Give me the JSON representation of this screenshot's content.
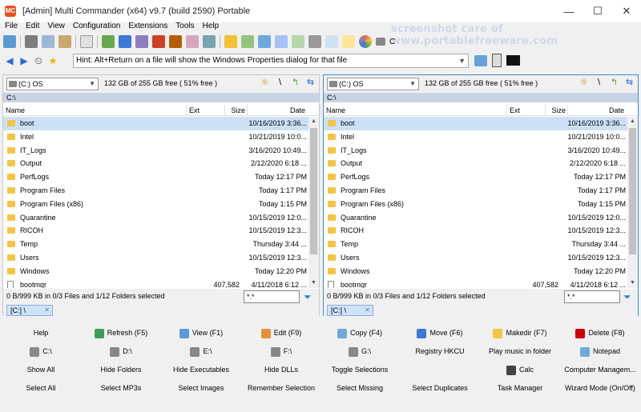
{
  "title": "[Admin] Multi Commander (x64)  v9.7 (build 2590) Portable",
  "watermark": "screenshot care of www.portablefreeware.com",
  "window_buttons": [
    "—",
    "☐",
    "✕"
  ],
  "menu": [
    "File",
    "Edit",
    "View",
    "Configuration",
    "Extensions",
    "Tools",
    "Help"
  ],
  "toolbar": {
    "drive_c_label": "C"
  },
  "hint": "Hint: Alt+Return on a file will show the Windows Properties dialog for that file",
  "colors": {
    "selection": "#cce0f5",
    "path_bar": "#c8d4e6",
    "folder": "#f5c542",
    "active_border": "#3a8fd6"
  },
  "left_panel": {
    "drive": "(C:) OS",
    "free": "132 GB of 255 GB free ( 51% free )",
    "path": "C:\\",
    "cols": {
      "name": "Name",
      "ext": "Ext",
      "size": "Size",
      "date": "Date"
    },
    "rows": [
      {
        "name": "boot",
        "size": "",
        "date": "10/16/2019 3:36...",
        "type": "folder",
        "sel": true
      },
      {
        "name": "Intel",
        "size": "",
        "date": "10/21/2019 10:0...",
        "type": "folder"
      },
      {
        "name": "IT_Logs",
        "size": "",
        "date": "3/16/2020 10:49...",
        "type": "folder"
      },
      {
        "name": "Output",
        "size": "",
        "date": "2/12/2020 6:18 ...",
        "type": "folder"
      },
      {
        "name": "PerfLogs",
        "size": "",
        "date": "Today 12:17 PM",
        "type": "folder"
      },
      {
        "name": "Program Files",
        "size": "",
        "date": "Today 1:17 PM",
        "type": "folder"
      },
      {
        "name": "Program Files (x86)",
        "size": "",
        "date": "Today 1:15 PM",
        "type": "folder"
      },
      {
        "name": "Quarantine",
        "size": "",
        "date": "10/15/2019 12:0...",
        "type": "folder"
      },
      {
        "name": "RICOH",
        "size": "",
        "date": "10/15/2019 12:3...",
        "type": "folder"
      },
      {
        "name": "Temp",
        "size": "",
        "date": "Thursday 3:44 ...",
        "type": "folder"
      },
      {
        "name": "Users",
        "size": "",
        "date": "10/15/2019 12:3...",
        "type": "folder"
      },
      {
        "name": "Windows",
        "size": "",
        "date": "Today 12:20 PM",
        "type": "folder"
      },
      {
        "name": "bootmgr",
        "size": "407,582",
        "date": "4/11/2018 6:12 ...",
        "type": "file"
      }
    ],
    "status": "0 B/999 KB in 0/3 Files and 1/12 Folders selected",
    "filter": "*.*",
    "tab": "[C:] \\"
  },
  "right_panel": {
    "drive": "(C:) OS",
    "free": "132 GB of 255 GB free ( 51% free )",
    "path": "C:\\",
    "cols": {
      "name": "Name",
      "ext": "Ext",
      "size": "Size",
      "date": "Date"
    },
    "rows": [
      {
        "name": "boot",
        "size": "",
        "date": "10/16/2019 3:36...",
        "type": "folder",
        "sel": true
      },
      {
        "name": "Intel",
        "size": "",
        "date": "10/21/2019 10:0...",
        "type": "folder"
      },
      {
        "name": "IT_Logs",
        "size": "",
        "date": "3/16/2020 10:49...",
        "type": "folder"
      },
      {
        "name": "Output",
        "size": "",
        "date": "2/12/2020 6:18 ...",
        "type": "folder"
      },
      {
        "name": "PerfLogs",
        "size": "",
        "date": "Today 12:17 PM",
        "type": "folder"
      },
      {
        "name": "Program Files",
        "size": "",
        "date": "Today 1:17 PM",
        "type": "folder"
      },
      {
        "name": "Program Files (x86)",
        "size": "",
        "date": "Today 1:15 PM",
        "type": "folder"
      },
      {
        "name": "Quarantine",
        "size": "",
        "date": "10/15/2019 12:0...",
        "type": "folder"
      },
      {
        "name": "RICOH",
        "size": "",
        "date": "10/15/2019 12:3...",
        "type": "folder"
      },
      {
        "name": "Temp",
        "size": "",
        "date": "Thursday 3:44 ...",
        "type": "folder"
      },
      {
        "name": "Users",
        "size": "",
        "date": "10/15/2019 12:3...",
        "type": "folder"
      },
      {
        "name": "Windows",
        "size": "",
        "date": "Today 12:20 PM",
        "type": "folder"
      },
      {
        "name": "bootmgr",
        "size": "407,582",
        "date": "4/11/2018 6:12 ...",
        "type": "file"
      }
    ],
    "status": "0 B/999 KB in 0/3 Files and 1/12 Folders selected",
    "filter": "*.*",
    "tab": "[C:] \\"
  },
  "buttons": [
    [
      {
        "label": "Help",
        "icon": ""
      },
      {
        "label": "Refresh (F5)",
        "icon": "refresh-icon"
      },
      {
        "label": "View (F1)",
        "icon": "view-icon"
      },
      {
        "label": "Edit (F9)",
        "icon": "edit-icon"
      },
      {
        "label": "Copy (F4)",
        "icon": "copy-icon"
      },
      {
        "label": "Move (F6)",
        "icon": "move-icon"
      },
      {
        "label": "Makedir (F7)",
        "icon": "folder-icon"
      },
      {
        "label": "Delete (F8)",
        "icon": "delete-icon"
      }
    ],
    [
      {
        "label": "C:\\",
        "icon": "drive-icon"
      },
      {
        "label": "D:\\",
        "icon": "drive-icon"
      },
      {
        "label": "E:\\",
        "icon": "drive-icon"
      },
      {
        "label": "F:\\",
        "icon": "drive-icon"
      },
      {
        "label": "G:\\",
        "icon": "drive-icon"
      },
      {
        "label": "Registry HKCU",
        "icon": ""
      },
      {
        "label": "Play music in folder",
        "icon": ""
      },
      {
        "label": "Notepad",
        "icon": "notepad-icon"
      }
    ],
    [
      {
        "label": "Show All",
        "icon": ""
      },
      {
        "label": "Hide Folders",
        "icon": ""
      },
      {
        "label": "Hide Executables",
        "icon": ""
      },
      {
        "label": "Hide DLLs",
        "icon": ""
      },
      {
        "label": "Toggle Selections",
        "icon": ""
      },
      {
        "label": "",
        "icon": ""
      },
      {
        "label": "Calc",
        "icon": "calc-icon"
      },
      {
        "label": "Computer Managem...",
        "icon": ""
      }
    ],
    [
      {
        "label": "Select All",
        "icon": ""
      },
      {
        "label": "Select MP3s",
        "icon": ""
      },
      {
        "label": "Select Images",
        "icon": ""
      },
      {
        "label": "Remember Selection",
        "icon": ""
      },
      {
        "label": "Select Missing",
        "icon": ""
      },
      {
        "label": "Select Duplicates",
        "icon": ""
      },
      {
        "label": "Task Manager",
        "icon": ""
      },
      {
        "label": "Wizard Mode (On/Off)",
        "icon": ""
      }
    ]
  ]
}
